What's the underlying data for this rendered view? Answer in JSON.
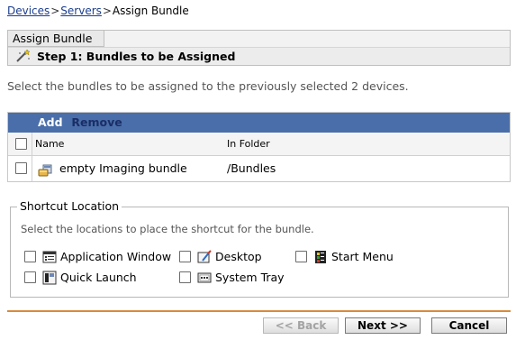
{
  "breadcrumb": {
    "items": [
      "Devices",
      "Servers"
    ],
    "current": "Assign Bundle",
    "separator": ">"
  },
  "panel": {
    "tab_label": "Assign Bundle",
    "step_title": "Step 1: Bundles to be Assigned"
  },
  "description": "Select the bundles to be assigned to the previously selected 2 devices.",
  "table": {
    "toolbar": {
      "add": "Add",
      "remove": "Remove"
    },
    "columns": {
      "name": "Name",
      "folder": "In Folder"
    },
    "rows": [
      {
        "name": "empty Imaging bundle",
        "folder": "/Bundles",
        "icon": "bundle-icon"
      }
    ]
  },
  "shortcut": {
    "legend": "Shortcut Location",
    "description": "Select the locations to place the shortcut for the bundle.",
    "options": [
      {
        "label": "Application Window",
        "icon": "application-window-icon"
      },
      {
        "label": "Desktop",
        "icon": "desktop-icon"
      },
      {
        "label": "Start Menu",
        "icon": "start-menu-icon"
      },
      {
        "label": "Quick Launch",
        "icon": "quick-launch-icon"
      },
      {
        "label": "System Tray",
        "icon": "system-tray-icon"
      }
    ]
  },
  "buttons": {
    "back": "<< Back",
    "next": "Next >>",
    "cancel": "Cancel"
  },
  "colors": {
    "toolbar_bg": "#4a6ea9",
    "link": "#1a3d8f",
    "rule": "#d98a3d"
  }
}
